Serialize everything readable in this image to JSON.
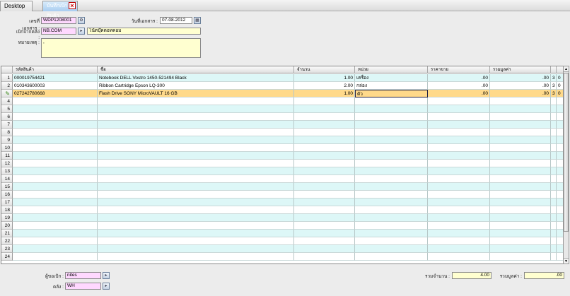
{
  "tabs": {
    "desktop": "Desktop",
    "active": "บันทึกเบิกสินค้า",
    "close_icon": "close-icon"
  },
  "header": {
    "doc_no_label": "เลขที่เอกสาร :",
    "doc_no_value": "WDP1208001",
    "doc_date_label": "วันที่เอกสาร :",
    "doc_date_value": "07-08-2012",
    "warehouse_label": "เบิกจากคลัง :",
    "warehouse_code": "NB.COM",
    "warehouse_name": "โน้ตบุ๊คดอทคอม",
    "remark_label": "หมายเหตุ :",
    "remark_value": ","
  },
  "grid": {
    "columns": [
      "รหัสสินค้า",
      "ชื่อ",
      "จำนวน",
      "หน่วย",
      "ราคาขาย",
      "รวมมูลค่า",
      "",
      ""
    ],
    "rows": [
      {
        "num": "1",
        "code": "000019754421",
        "name": "Notebook DELL Vostro 1450-521494 Black",
        "qty": "1.00",
        "unit": "เครื่อง",
        "price": ".00",
        "total": ".00",
        "c7": "3",
        "c8": "0"
      },
      {
        "num": "2",
        "code": "010343600003",
        "name": "Ribbon Cartridge Epson LQ-300",
        "qty": "2.00",
        "unit": "กล่อง",
        "price": ".00",
        "total": ".00",
        "c7": "3",
        "c8": "0"
      },
      {
        "num": "",
        "code": "027242780668",
        "name": "Flash Drive SONY MicroVAULT 16 GB",
        "qty": "1.00",
        "unit": "ตัว",
        "price": ".00",
        "total": ".00",
        "c7": "3",
        "c8": "0"
      },
      {
        "num": "4"
      },
      {
        "num": "5"
      },
      {
        "num": "6"
      },
      {
        "num": "7"
      },
      {
        "num": "8"
      },
      {
        "num": "9"
      },
      {
        "num": "10"
      },
      {
        "num": "11"
      },
      {
        "num": "12"
      },
      {
        "num": "13"
      },
      {
        "num": "14"
      },
      {
        "num": "15"
      },
      {
        "num": "16"
      },
      {
        "num": "17"
      },
      {
        "num": "18"
      },
      {
        "num": "19"
      },
      {
        "num": "20"
      },
      {
        "num": "21"
      },
      {
        "num": "22"
      },
      {
        "num": "23"
      },
      {
        "num": "24"
      }
    ],
    "edit_icon": "pencil-icon",
    "selected_row": 2
  },
  "footer": {
    "requester_label": "ผู้ขอเบิก :",
    "requester_value": "nites",
    "warehouse_label": "คลัง :",
    "warehouse_value": "WH",
    "total_qty_label": "รวมจำนวน :",
    "total_qty_value": "4.00",
    "total_value_label": "รวมมูลค่า :",
    "total_value_value": ".00"
  }
}
